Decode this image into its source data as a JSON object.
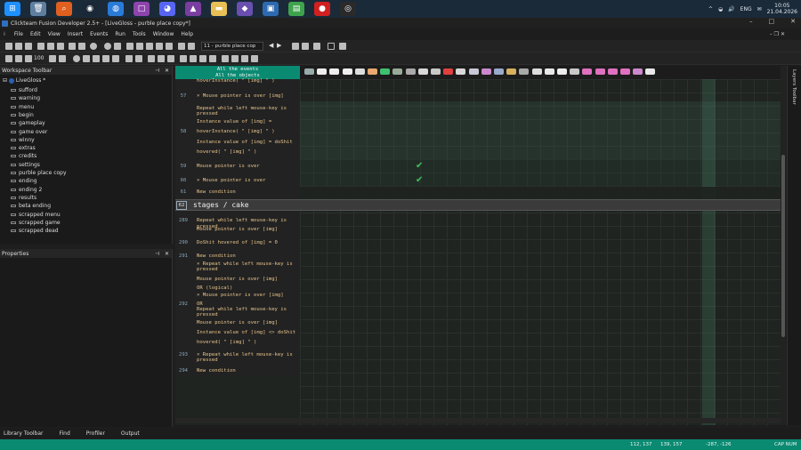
{
  "taskbar": {
    "apps": [
      {
        "icon": "windows-start-icon",
        "color": "#1e90ff",
        "glyph": "⊞"
      },
      {
        "icon": "recycle-bin-icon",
        "color": "#5f7f9f",
        "glyph": "🗑"
      },
      {
        "icon": "search-app-icon",
        "color": "#e06020",
        "glyph": "⌕"
      },
      {
        "icon": "steam-icon",
        "color": "#1b2838",
        "glyph": "◉"
      },
      {
        "icon": "app-blue-icon",
        "color": "#2a7bd8",
        "glyph": "◍"
      },
      {
        "icon": "app-purple-icon",
        "color": "#8e44ad",
        "glyph": "□"
      },
      {
        "icon": "discord-icon",
        "color": "#5865f2",
        "glyph": "◕"
      },
      {
        "icon": "app-triangle-icon",
        "color": "#7a3da0",
        "glyph": "▲"
      },
      {
        "icon": "folder-icon",
        "color": "#e8c055",
        "glyph": "▬"
      },
      {
        "icon": "app-gem-icon",
        "color": "#6a4fb0",
        "glyph": "◆"
      },
      {
        "icon": "app-window-icon",
        "color": "#2e6ab0",
        "glyph": "▣"
      },
      {
        "icon": "app-green-icon",
        "color": "#3fa34d",
        "glyph": "▤"
      },
      {
        "icon": "record-icon",
        "color": "#d02020",
        "glyph": "●"
      },
      {
        "icon": "obs-icon",
        "color": "#2a2a2a",
        "glyph": "◎"
      }
    ],
    "tray_lang": "ENG",
    "time": "10:05",
    "date": "21.04.2026"
  },
  "window": {
    "title": "Clickteam Fusion Developer 2.5+ - [LiveGloss - purble place copy*]"
  },
  "menu": [
    "File",
    "Edit",
    "View",
    "Insert",
    "Events",
    "Run",
    "Tools",
    "Window",
    "Help"
  ],
  "toolbar": {
    "zoom": "100",
    "frame_select": "11 - purble place cop"
  },
  "workspace": {
    "title": "Workspace Toolbar",
    "root": "LiveGloss *",
    "items": [
      "sufford",
      "warning",
      "menu",
      "begin",
      "gameplay",
      "game over",
      "winny",
      "extras",
      "credits",
      "settings",
      "purble place copy",
      "ending",
      "ending 2",
      "results",
      "beta ending",
      "scrapped menu",
      "scrapped game",
      "scrapped dead"
    ]
  },
  "properties": {
    "title": "Properties"
  },
  "editor": {
    "header_line1": "All the events",
    "header_line2": "All the objects",
    "rows": [
      {
        "num": "",
        "text": "hoverInstance( \" [img] \" )"
      },
      {
        "num": "57",
        "text": "× Mouse pointer is over [img]"
      },
      {
        "num": "",
        "text": "Repeat while left mouse-key is"
      },
      {
        "num": "",
        "text": "pressed"
      },
      {
        "num": "",
        "text": "Instance value of [img] ="
      },
      {
        "num": "58",
        "text": "hoverInstance( \" [img] \" )"
      },
      {
        "num": "",
        "text": "Instance value of [img] = doShit"
      },
      {
        "num": "",
        "text": "hovered( \" [img] \" )"
      },
      {
        "num": "59",
        "text": "Mouse pointer is over"
      },
      {
        "num": "60",
        "text": "× Mouse pointer is over"
      },
      {
        "num": "61",
        "text": "New condition"
      },
      {
        "num": "289",
        "text": "Repeat while left mouse-key is"
      },
      {
        "num": "",
        "text": "pressed"
      },
      {
        "num": "",
        "text": "Mouse pointer is over [img]"
      },
      {
        "num": "290",
        "text": "DoShit hovered of [img] = 0"
      },
      {
        "num": "291",
        "text": "New condition"
      },
      {
        "num": "",
        "text": "× Repeat while left mouse-key is"
      },
      {
        "num": "",
        "text": "pressed"
      },
      {
        "num": "",
        "text": "Mouse pointer is over [img]"
      },
      {
        "num": "",
        "text": "OR (logical)"
      },
      {
        "num": "",
        "text": "× Mouse pointer is over [img]"
      },
      {
        "num": "292",
        "text": "OR"
      },
      {
        "num": "",
        "text": "Repeat while left mouse-key is"
      },
      {
        "num": "",
        "text": "pressed"
      },
      {
        "num": "",
        "text": "Mouse pointer is over [img]"
      },
      {
        "num": "",
        "text": "Instance value of [img] <> doShit"
      },
      {
        "num": "",
        "text": "hovered( \" [img] \" )"
      },
      {
        "num": "293",
        "text": "× Repeat while left mouse-key is"
      },
      {
        "num": "",
        "text": "pressed"
      },
      {
        "num": "294",
        "text": "New condition"
      }
    ],
    "group_number": "62",
    "group_title": "stages / cake"
  },
  "layers_title": "Layers Toolbar",
  "bottom_tabs": [
    "Library Toolbar",
    "Find",
    "Profiler",
    "Output"
  ],
  "status": {
    "coord1": "112, 137",
    "coord2": "139, 157",
    "coord3": "-287, -126",
    "keys": "CAP NUM"
  }
}
